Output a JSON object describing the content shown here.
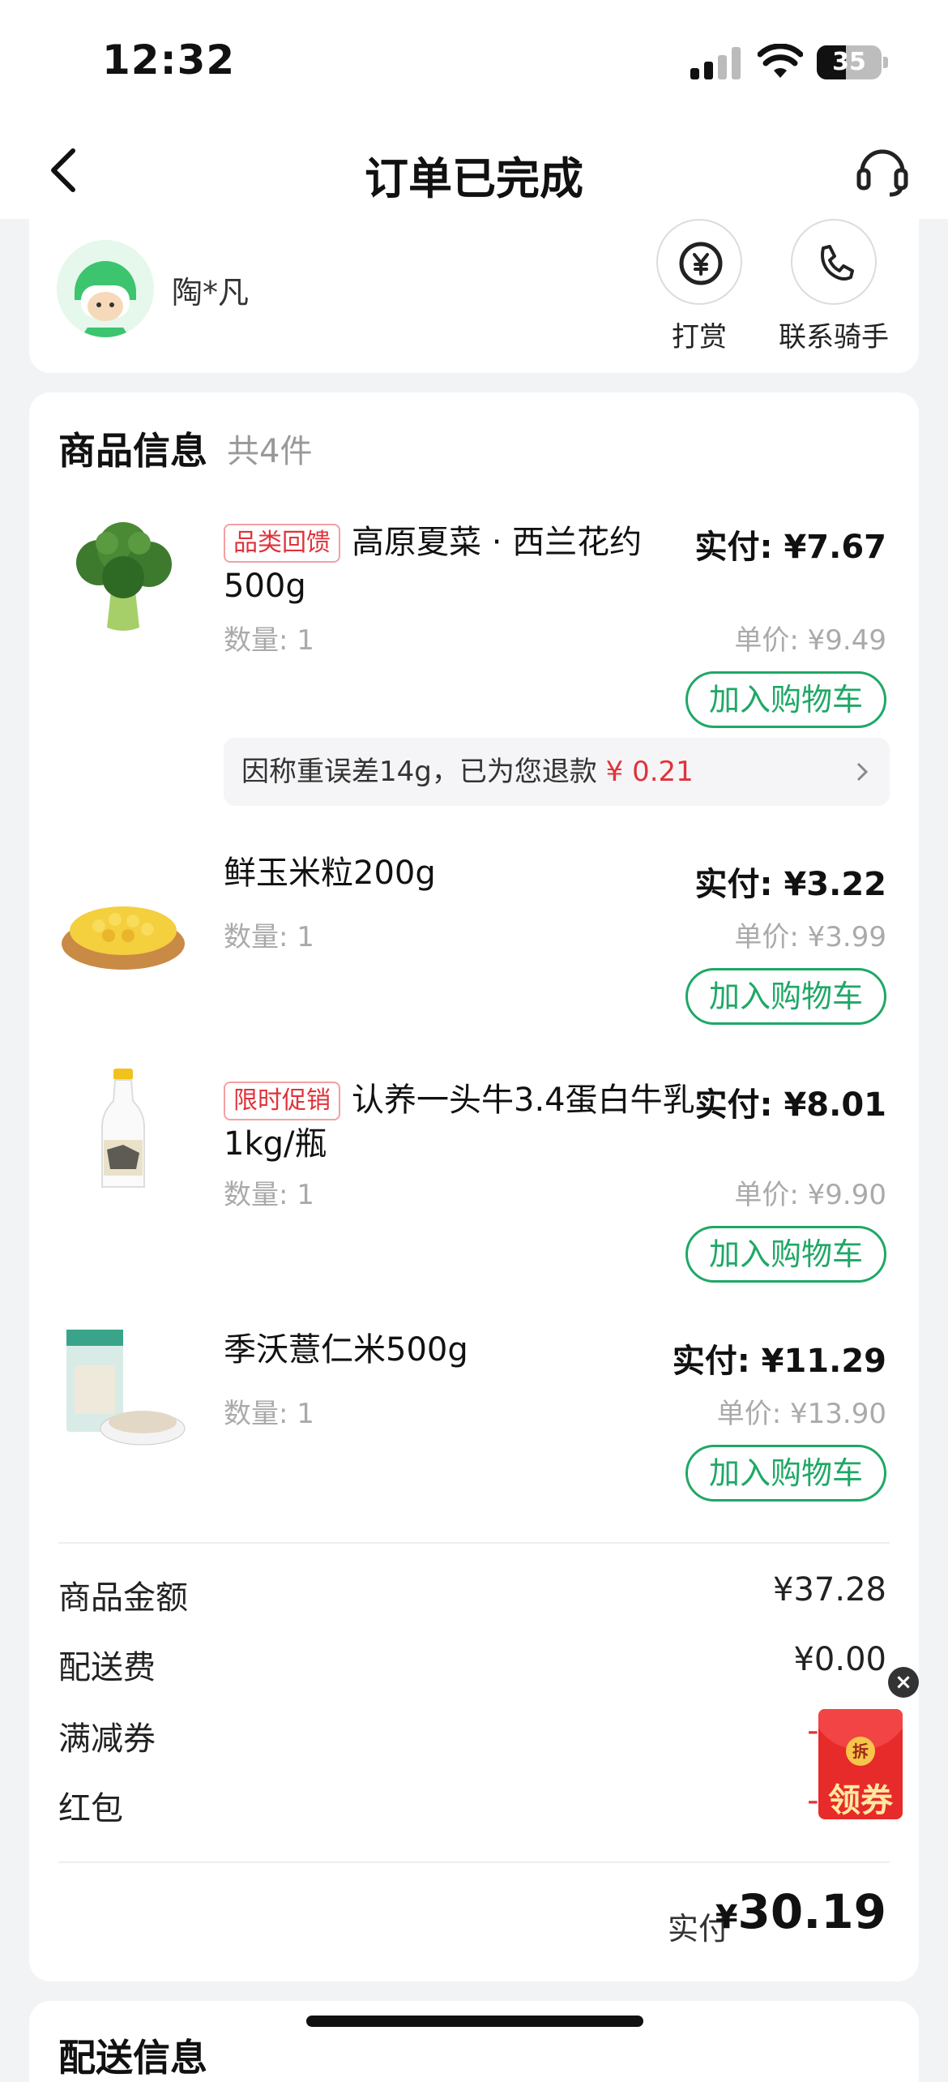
{
  "status": {
    "time": "12:32",
    "battery": "35"
  },
  "nav": {
    "title": "订单已完成"
  },
  "rider": {
    "name": "陶*凡",
    "tip_label": "打赏",
    "contact_label": "联系骑手"
  },
  "products": {
    "title": "商品信息",
    "count": "共4件",
    "add_label": "加入购物车",
    "items": [
      {
        "tag": "品类回馈",
        "name": "高原夏菜 · 西兰花约500g",
        "qty": "数量: 1",
        "paid": "实付: ¥7.67",
        "unit": "单价: ¥9.49"
      },
      {
        "tag": "",
        "name": "鲜玉米粒200g",
        "qty": "数量: 1",
        "paid": "实付: ¥3.22",
        "unit": "单价: ¥3.99"
      },
      {
        "tag": "限时促销",
        "name": "认养一头牛3.4蛋白牛乳1kg/瓶",
        "qty": "数量: 1",
        "paid": "实付: ¥8.01",
        "unit": "单价: ¥9.90"
      },
      {
        "tag": "",
        "name": "季沃薏仁米500g",
        "qty": "数量: 1",
        "paid": "实付: ¥11.29",
        "unit": "单价: ¥13.90"
      }
    ],
    "refund": {
      "text": "因称重误差14g，已为您退款",
      "amount": "¥ 0.21"
    }
  },
  "fees": {
    "goods_label": "商品金额",
    "goods_value": "¥37.28",
    "delivery_label": "配送费",
    "delivery_value": "¥0.00",
    "discount_label": "满减券",
    "discount_value": "-¥",
    "redpacket_label": "红包",
    "redpacket_value": "-¥"
  },
  "total": {
    "label": "实付",
    "currency": "¥",
    "value": "30.19"
  },
  "delivery_section": {
    "title": "配送信息"
  },
  "coupon_float": {
    "seal": "拆",
    "label": "领券",
    "close": "×"
  },
  "colors": {
    "accent": "#1fa866",
    "red": "#e0323a"
  }
}
